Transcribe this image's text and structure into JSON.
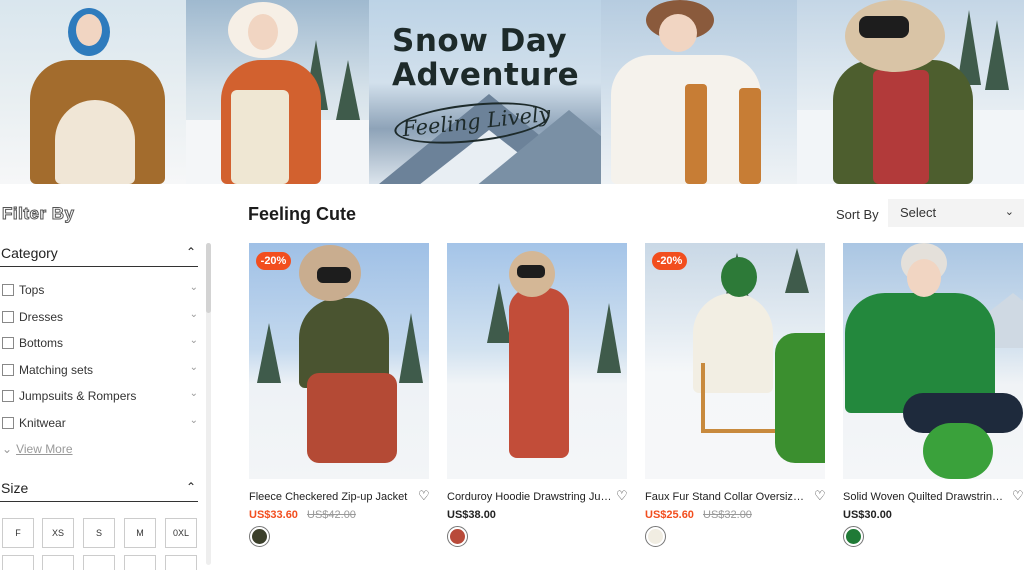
{
  "banner": {
    "title_line1": "Snow Day",
    "title_line2": "Adventure",
    "subtitle": "Feeling Lively"
  },
  "sidebar": {
    "filter_title": "Filter By",
    "category": {
      "label": "Category",
      "items": [
        {
          "label": "Tops"
        },
        {
          "label": "Dresses"
        },
        {
          "label": "Bottoms"
        },
        {
          "label": "Matching sets"
        },
        {
          "label": "Jumpsuits & Rompers"
        },
        {
          "label": "Knitwear"
        }
      ],
      "view_more": "View More"
    },
    "size": {
      "label": "Size",
      "options": [
        "F",
        "XS",
        "S",
        "M",
        "0XL"
      ]
    }
  },
  "main": {
    "section_title": "Feeling Cute",
    "sort_label": "Sort By",
    "sort_value": "Select",
    "products": [
      {
        "name": "Fleece Checkered Zip-up Jacket",
        "badge": "-20%",
        "price": "US$33.60",
        "original_price": "US$42.00",
        "swatch_color": "#3b3f2a"
      },
      {
        "name": "Corduroy Hoodie Drawstring Jumpsuit",
        "badge": "",
        "price": "US$38.00",
        "original_price": "",
        "swatch_color": "#b84a3a"
      },
      {
        "name": "Faux Fur Stand Collar Oversized Jacket",
        "badge": "-20%",
        "price": "US$25.60",
        "original_price": "US$32.00",
        "swatch_color": "#f1ede2"
      },
      {
        "name": "Solid Woven Quilted Drawstring Hoodie",
        "badge": "",
        "price": "US$30.00",
        "original_price": "",
        "swatch_color": "#1f7a36"
      }
    ]
  },
  "colors": {
    "sale": "#f24e1e",
    "accent_text": "#1c1c1c"
  }
}
